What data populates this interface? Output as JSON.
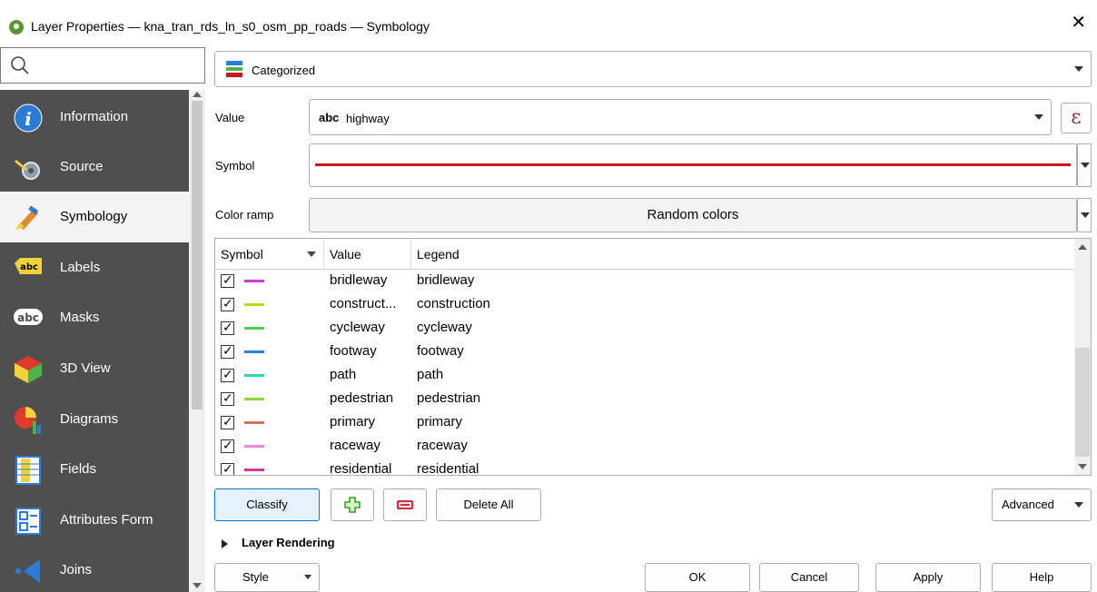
{
  "window": {
    "title": "Layer Properties — kna_tran_rds_ln_s0_osm_pp_roads — Symbology"
  },
  "sidebar": {
    "search_placeholder": "",
    "items": [
      {
        "label": "Information",
        "icon": "information-icon"
      },
      {
        "label": "Source",
        "icon": "source-icon"
      },
      {
        "label": "Symbology",
        "icon": "symbology-icon",
        "active": true
      },
      {
        "label": "Labels",
        "icon": "labels-icon"
      },
      {
        "label": "Masks",
        "icon": "masks-icon"
      },
      {
        "label": "3D View",
        "icon": "3d-view-icon"
      },
      {
        "label": "Diagrams",
        "icon": "diagrams-icon"
      },
      {
        "label": "Fields",
        "icon": "fields-icon"
      },
      {
        "label": "Attributes Form",
        "icon": "attributes-form-icon"
      },
      {
        "label": "Joins",
        "icon": "joins-icon"
      }
    ]
  },
  "renderer": {
    "selected": "Categorized"
  },
  "form": {
    "value_label": "Value",
    "value_type": "abc",
    "value_field": "highway",
    "symbol_label": "Symbol",
    "symbol_color": "#c8161d",
    "ramp_label": "Color ramp",
    "ramp_value": "Random colors",
    "expression_icon": "ε"
  },
  "table": {
    "headers": {
      "symbol": "Symbol",
      "value": "Value",
      "legend": "Legend"
    },
    "rows": [
      {
        "value": "bridleway",
        "legend": "bridleway",
        "color": "#c83ed6",
        "checked": true
      },
      {
        "value": "construct...",
        "legend": "construction",
        "color": "#c2d41f",
        "checked": true
      },
      {
        "value": "cycleway",
        "legend": "cycleway",
        "color": "#4fd14a",
        "checked": true
      },
      {
        "value": "footway",
        "legend": "footway",
        "color": "#2f7fd6",
        "checked": true
      },
      {
        "value": "path",
        "legend": "path",
        "color": "#2fd6a6",
        "checked": true
      },
      {
        "value": "pedestrian",
        "legend": "pedestrian",
        "color": "#8ed63a",
        "checked": true
      },
      {
        "value": "primary",
        "legend": "primary",
        "color": "#d6725a",
        "checked": true
      },
      {
        "value": "raceway",
        "legend": "raceway",
        "color": "#e68ad9",
        "checked": true
      },
      {
        "value": "residential",
        "legend": "residential",
        "color": "#d63a8a",
        "checked": true
      }
    ]
  },
  "actions": {
    "classify": "Classify",
    "delete_all": "Delete All",
    "advanced": "Advanced"
  },
  "section": {
    "layer_rendering": "Layer Rendering"
  },
  "footer": {
    "style": "Style",
    "ok": "OK",
    "cancel": "Cancel",
    "apply": "Apply",
    "help": "Help"
  }
}
